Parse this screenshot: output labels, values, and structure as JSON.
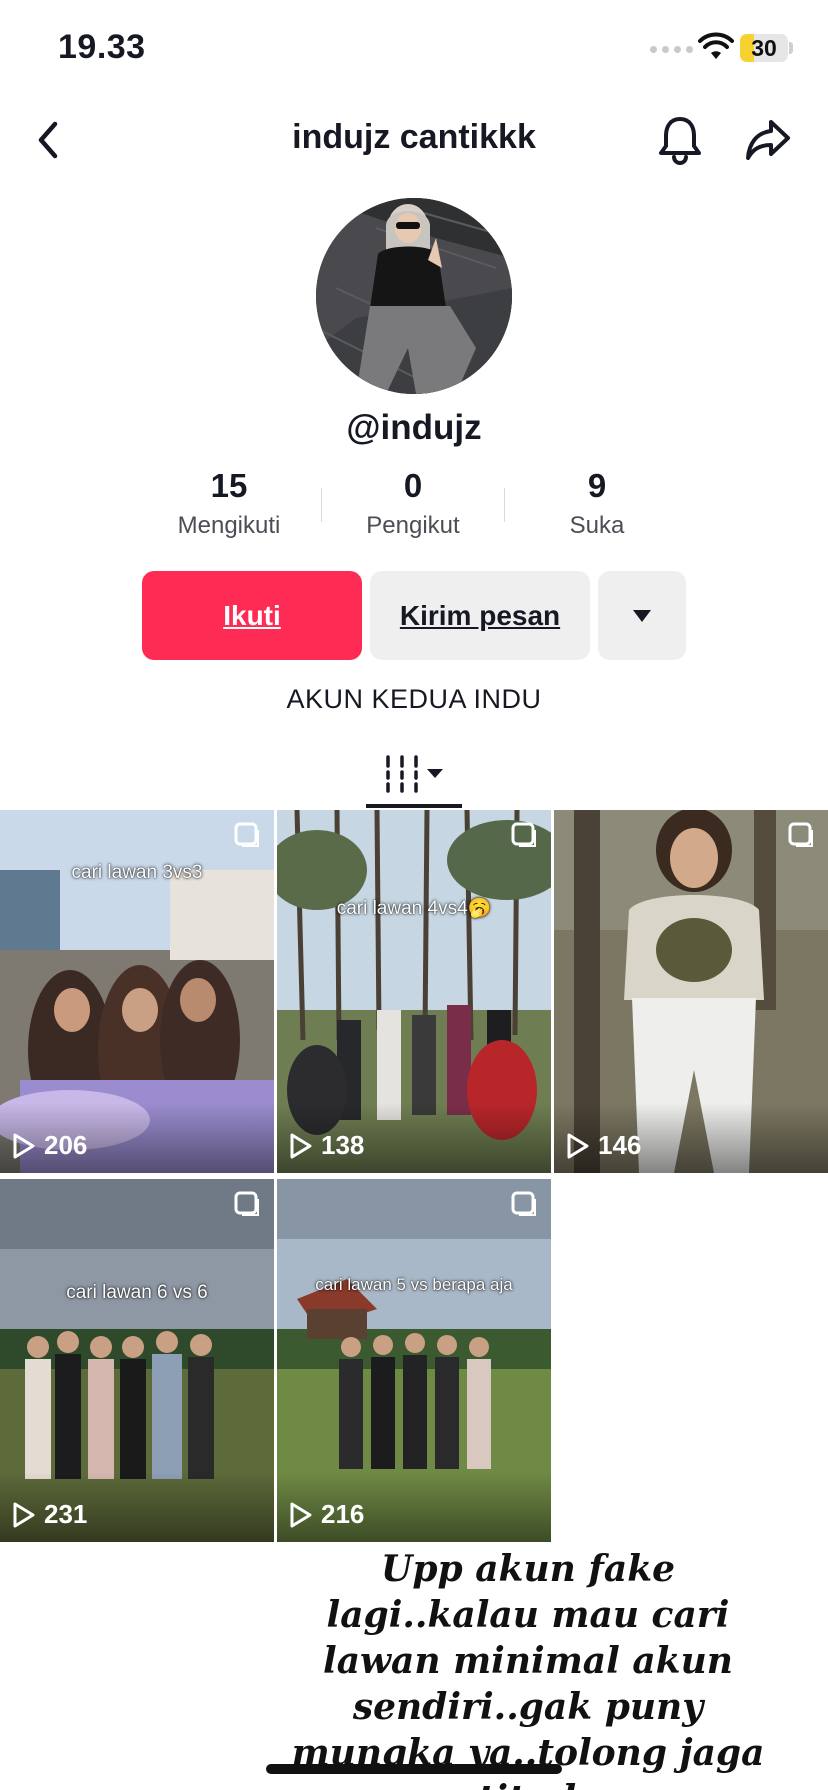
{
  "status_bar": {
    "time": "19.33",
    "battery_level": "30",
    "battery_color": "#f7d12f"
  },
  "header": {
    "title": "indujz cantikkk",
    "back_icon": "chevron-left-icon",
    "notification_icon": "bell-icon",
    "share_icon": "share-arrow-icon"
  },
  "profile": {
    "username": "@indujz",
    "stats": [
      {
        "value": "15",
        "label": "Mengikuti"
      },
      {
        "value": "0",
        "label": "Pengikut"
      },
      {
        "value": "9",
        "label": "Suka"
      }
    ],
    "bio": "AKUN KEDUA INDU"
  },
  "actions": {
    "follow_label": "Ikuti",
    "message_label": "Kirim pesan",
    "more_icon": "caret-down-icon"
  },
  "tabs": {
    "videos_icon": "grid-filter-icon"
  },
  "videos": [
    {
      "views": "206",
      "caption": "cari lawan 3vs3"
    },
    {
      "views": "138",
      "caption": "cari lawan 4vs4🥱"
    },
    {
      "views": "146",
      "caption": ""
    },
    {
      "views": "231",
      "caption": "cari lawan 6 vs 6"
    },
    {
      "views": "216",
      "caption": "cari lawan 5 vs berapa aja"
    }
  ],
  "overlay_text": "Upp akun fake lagi..kalau mau cari lawan minimal akun sendiri..gak puny mungka ya..tolong jaga etitud..",
  "colors": {
    "accent": "#fe2c55",
    "secondary_button": "#efefef",
    "text": "#161823"
  }
}
